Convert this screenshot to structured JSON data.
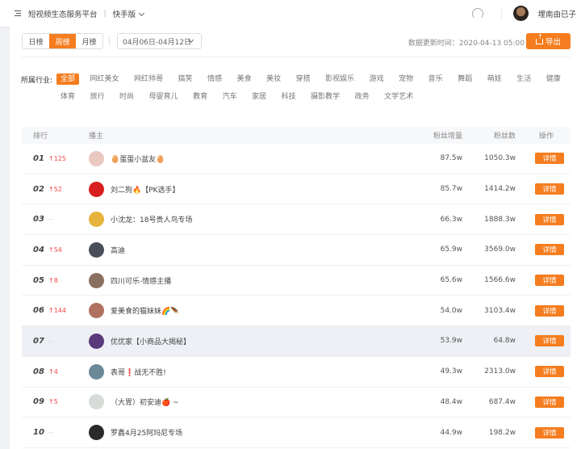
{
  "header": {
    "title": "短视频生态服务平台",
    "separator": "|",
    "version": "快手版",
    "username": "埋南由已子"
  },
  "toolbar": {
    "tabs": [
      {
        "label": "日榜"
      },
      {
        "label": "周榜",
        "active": true
      },
      {
        "label": "月榜"
      }
    ],
    "date_range": "04月06日-04月12日",
    "updated": "数据更新时间：2020-04-13 05:00",
    "export_label": "导出"
  },
  "industry": {
    "label": "所属行业:",
    "items": [
      "全部",
      "网红美女",
      "网红帅哥",
      "搞笑",
      "情感",
      "美食",
      "美妆",
      "穿搭",
      "影视娱乐",
      "游戏",
      "宠物",
      "音乐",
      "舞蹈",
      "萌娃",
      "生活",
      "健康",
      "体育",
      "旅行",
      "时尚",
      "母婴育儿",
      "教育",
      "汽车",
      "家居",
      "科技",
      "摄影教学",
      "政务",
      "文学艺术"
    ],
    "selected": "全部"
  },
  "table": {
    "headers": {
      "rank": "排行",
      "anchor": "播主",
      "increase": "粉丝增量",
      "fans": "粉丝数",
      "action": "操作"
    },
    "rows": [
      {
        "rank": "01",
        "change": "↑125",
        "name": "🥚蛋蛋小盆友🥚",
        "increase": "87.5w",
        "fans": "1050.3w",
        "action": "详情",
        "avatar": "#e8c8c0"
      },
      {
        "rank": "02",
        "change": "↑52",
        "name": "刘二狗🔥【PK选手】",
        "increase": "85.7w",
        "fans": "1414.2w",
        "action": "详情",
        "avatar": "#d81e1e"
      },
      {
        "rank": "03",
        "change": "--",
        "name": "小沈龙：18号贵人鸟专场",
        "increase": "66.3w",
        "fans": "1888.3w",
        "action": "详情",
        "avatar": "#e6b43c"
      },
      {
        "rank": "04",
        "change": "↑54",
        "name": "高迪",
        "increase": "65.9w",
        "fans": "3569.0w",
        "action": "详情",
        "avatar": "#4a4e5a"
      },
      {
        "rank": "05",
        "change": "↑8",
        "name": "四川可乐-情感主播",
        "increase": "65.6w",
        "fans": "1566.6w",
        "action": "详情",
        "avatar": "#8a7060"
      },
      {
        "rank": "06",
        "change": "↑144",
        "name": "爱美食的猫妹妹🌈🪶",
        "increase": "54.0w",
        "fans": "3103.4w",
        "action": "详情",
        "avatar": "#b07060"
      },
      {
        "rank": "07",
        "change": "--",
        "name": "优优家【小商品大揭秘】",
        "increase": "53.9w",
        "fans": "64.8w",
        "action": "详情",
        "avatar": "#5a3a7a",
        "highlight": true
      },
      {
        "rank": "08",
        "change": "↑4",
        "name": "表哥❗战无不胜!",
        "increase": "49.3w",
        "fans": "2313.0w",
        "action": "详情",
        "avatar": "#6a8a9a"
      },
      {
        "rank": "09",
        "change": "↑5",
        "name": "（大胃）初安迪🍎 ~",
        "increase": "48.4w",
        "fans": "687.4w",
        "action": "详情",
        "avatar": "#d8dcd8"
      },
      {
        "rank": "10",
        "change": "--",
        "name": "罗鑫4月25阿玛尼专场",
        "increase": "44.9w",
        "fans": "198.2w",
        "action": "详情",
        "avatar": "#2a2a2a"
      }
    ]
  },
  "colors": {
    "accent": "#f57d1f",
    "up": "#f04848"
  }
}
